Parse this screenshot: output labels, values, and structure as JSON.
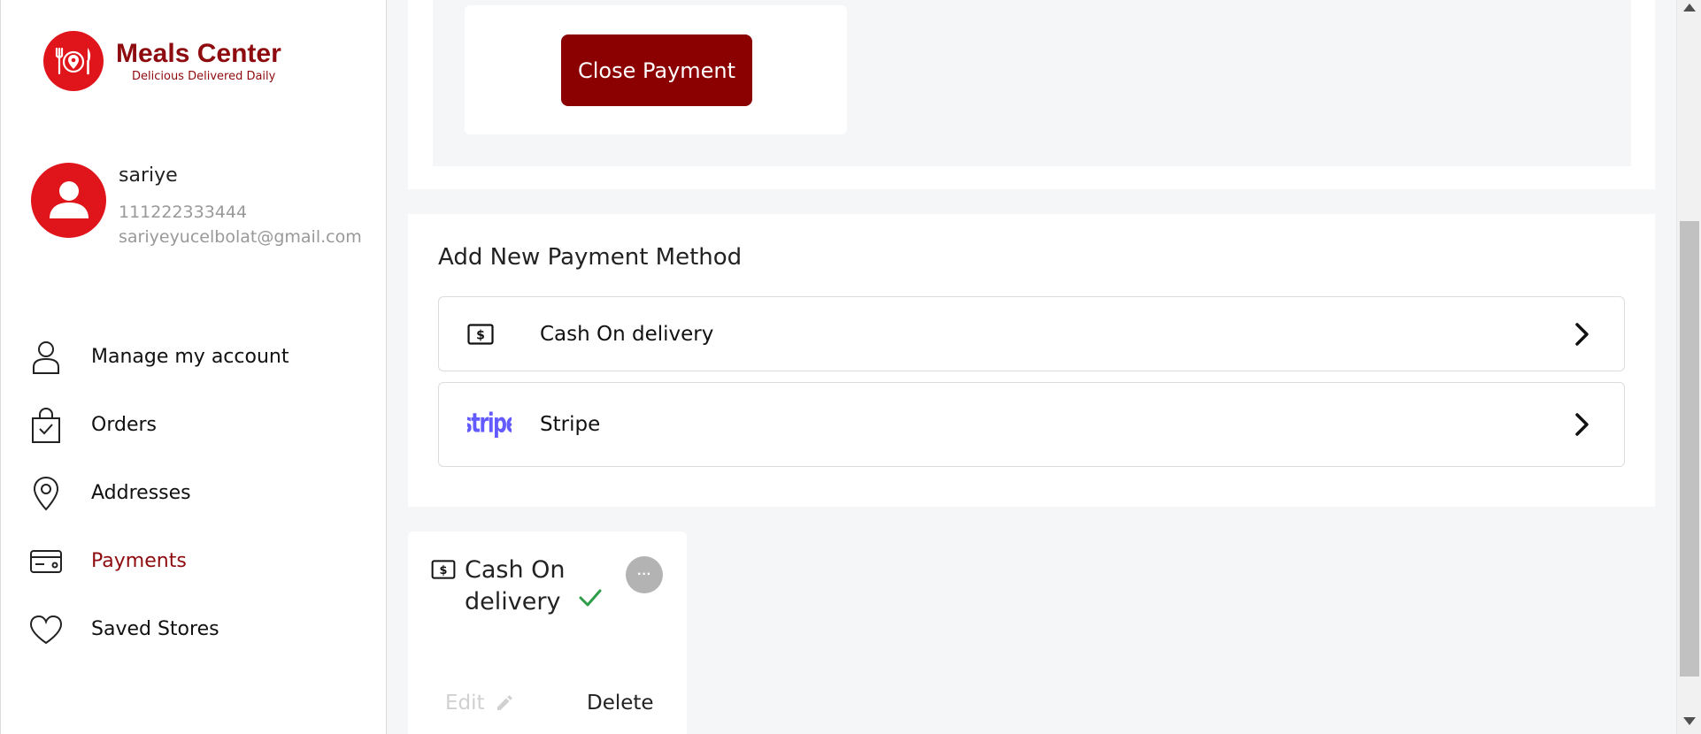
{
  "brand": {
    "name": "Meals Center",
    "tagline": "Delicious Delivered Daily",
    "color": "#e0151b",
    "dark_color": "#8e0b0f"
  },
  "profile": {
    "name": "sariye",
    "phone": "111222333444",
    "email": "sariyeyucelbolat@gmail.com"
  },
  "sidebar": {
    "items": [
      {
        "label": "Manage my account",
        "icon": "user-icon",
        "active": false
      },
      {
        "label": "Orders",
        "icon": "shopping-bag-icon",
        "active": false
      },
      {
        "label": "Addresses",
        "icon": "location-pin-icon",
        "active": false
      },
      {
        "label": "Payments",
        "icon": "credit-card-icon",
        "active": true
      },
      {
        "label": "Saved Stores",
        "icon": "heart-icon",
        "active": false
      }
    ]
  },
  "top_panel": {
    "close_label": "Close Payment"
  },
  "add_method": {
    "title": "Add New Payment Method",
    "methods": [
      {
        "label": "Cash On delivery",
        "icon": "cash-icon"
      },
      {
        "label": "Stripe",
        "icon": "stripe-logo"
      }
    ]
  },
  "saved_method": {
    "title": "Cash On delivery",
    "edit_label": "Edit",
    "delete_label": "Delete",
    "more_label": "···"
  }
}
